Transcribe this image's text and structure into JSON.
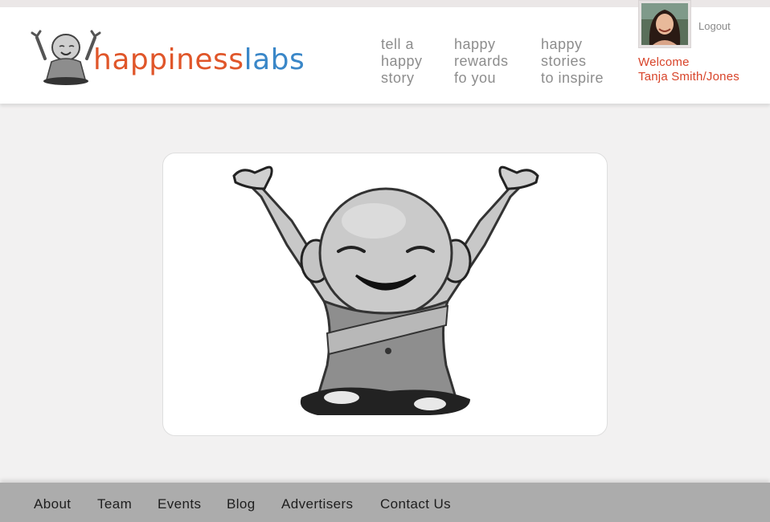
{
  "brand": {
    "word1": "happiness",
    "word2": "labs",
    "color_orange": "#e0562a",
    "color_blue": "#3a87c8"
  },
  "nav": {
    "items": [
      {
        "line1": "tell a",
        "line2": "happy",
        "line3": "story"
      },
      {
        "line1": "happy",
        "line2": "rewards",
        "line3": "fo you"
      },
      {
        "line1": "happy",
        "line2": "stories",
        "line3": "to inspire"
      }
    ]
  },
  "user": {
    "logout_label": "Logout",
    "welcome_label": "Welcome",
    "name": "Tanja Smith/Jones",
    "avatar_icon": "user-photo"
  },
  "hero": {
    "image_icon": "smiling-monk-mascot"
  },
  "footer": {
    "links": [
      "About",
      "Team",
      "Events",
      "Blog",
      "Advertisers",
      "Contact Us"
    ]
  }
}
